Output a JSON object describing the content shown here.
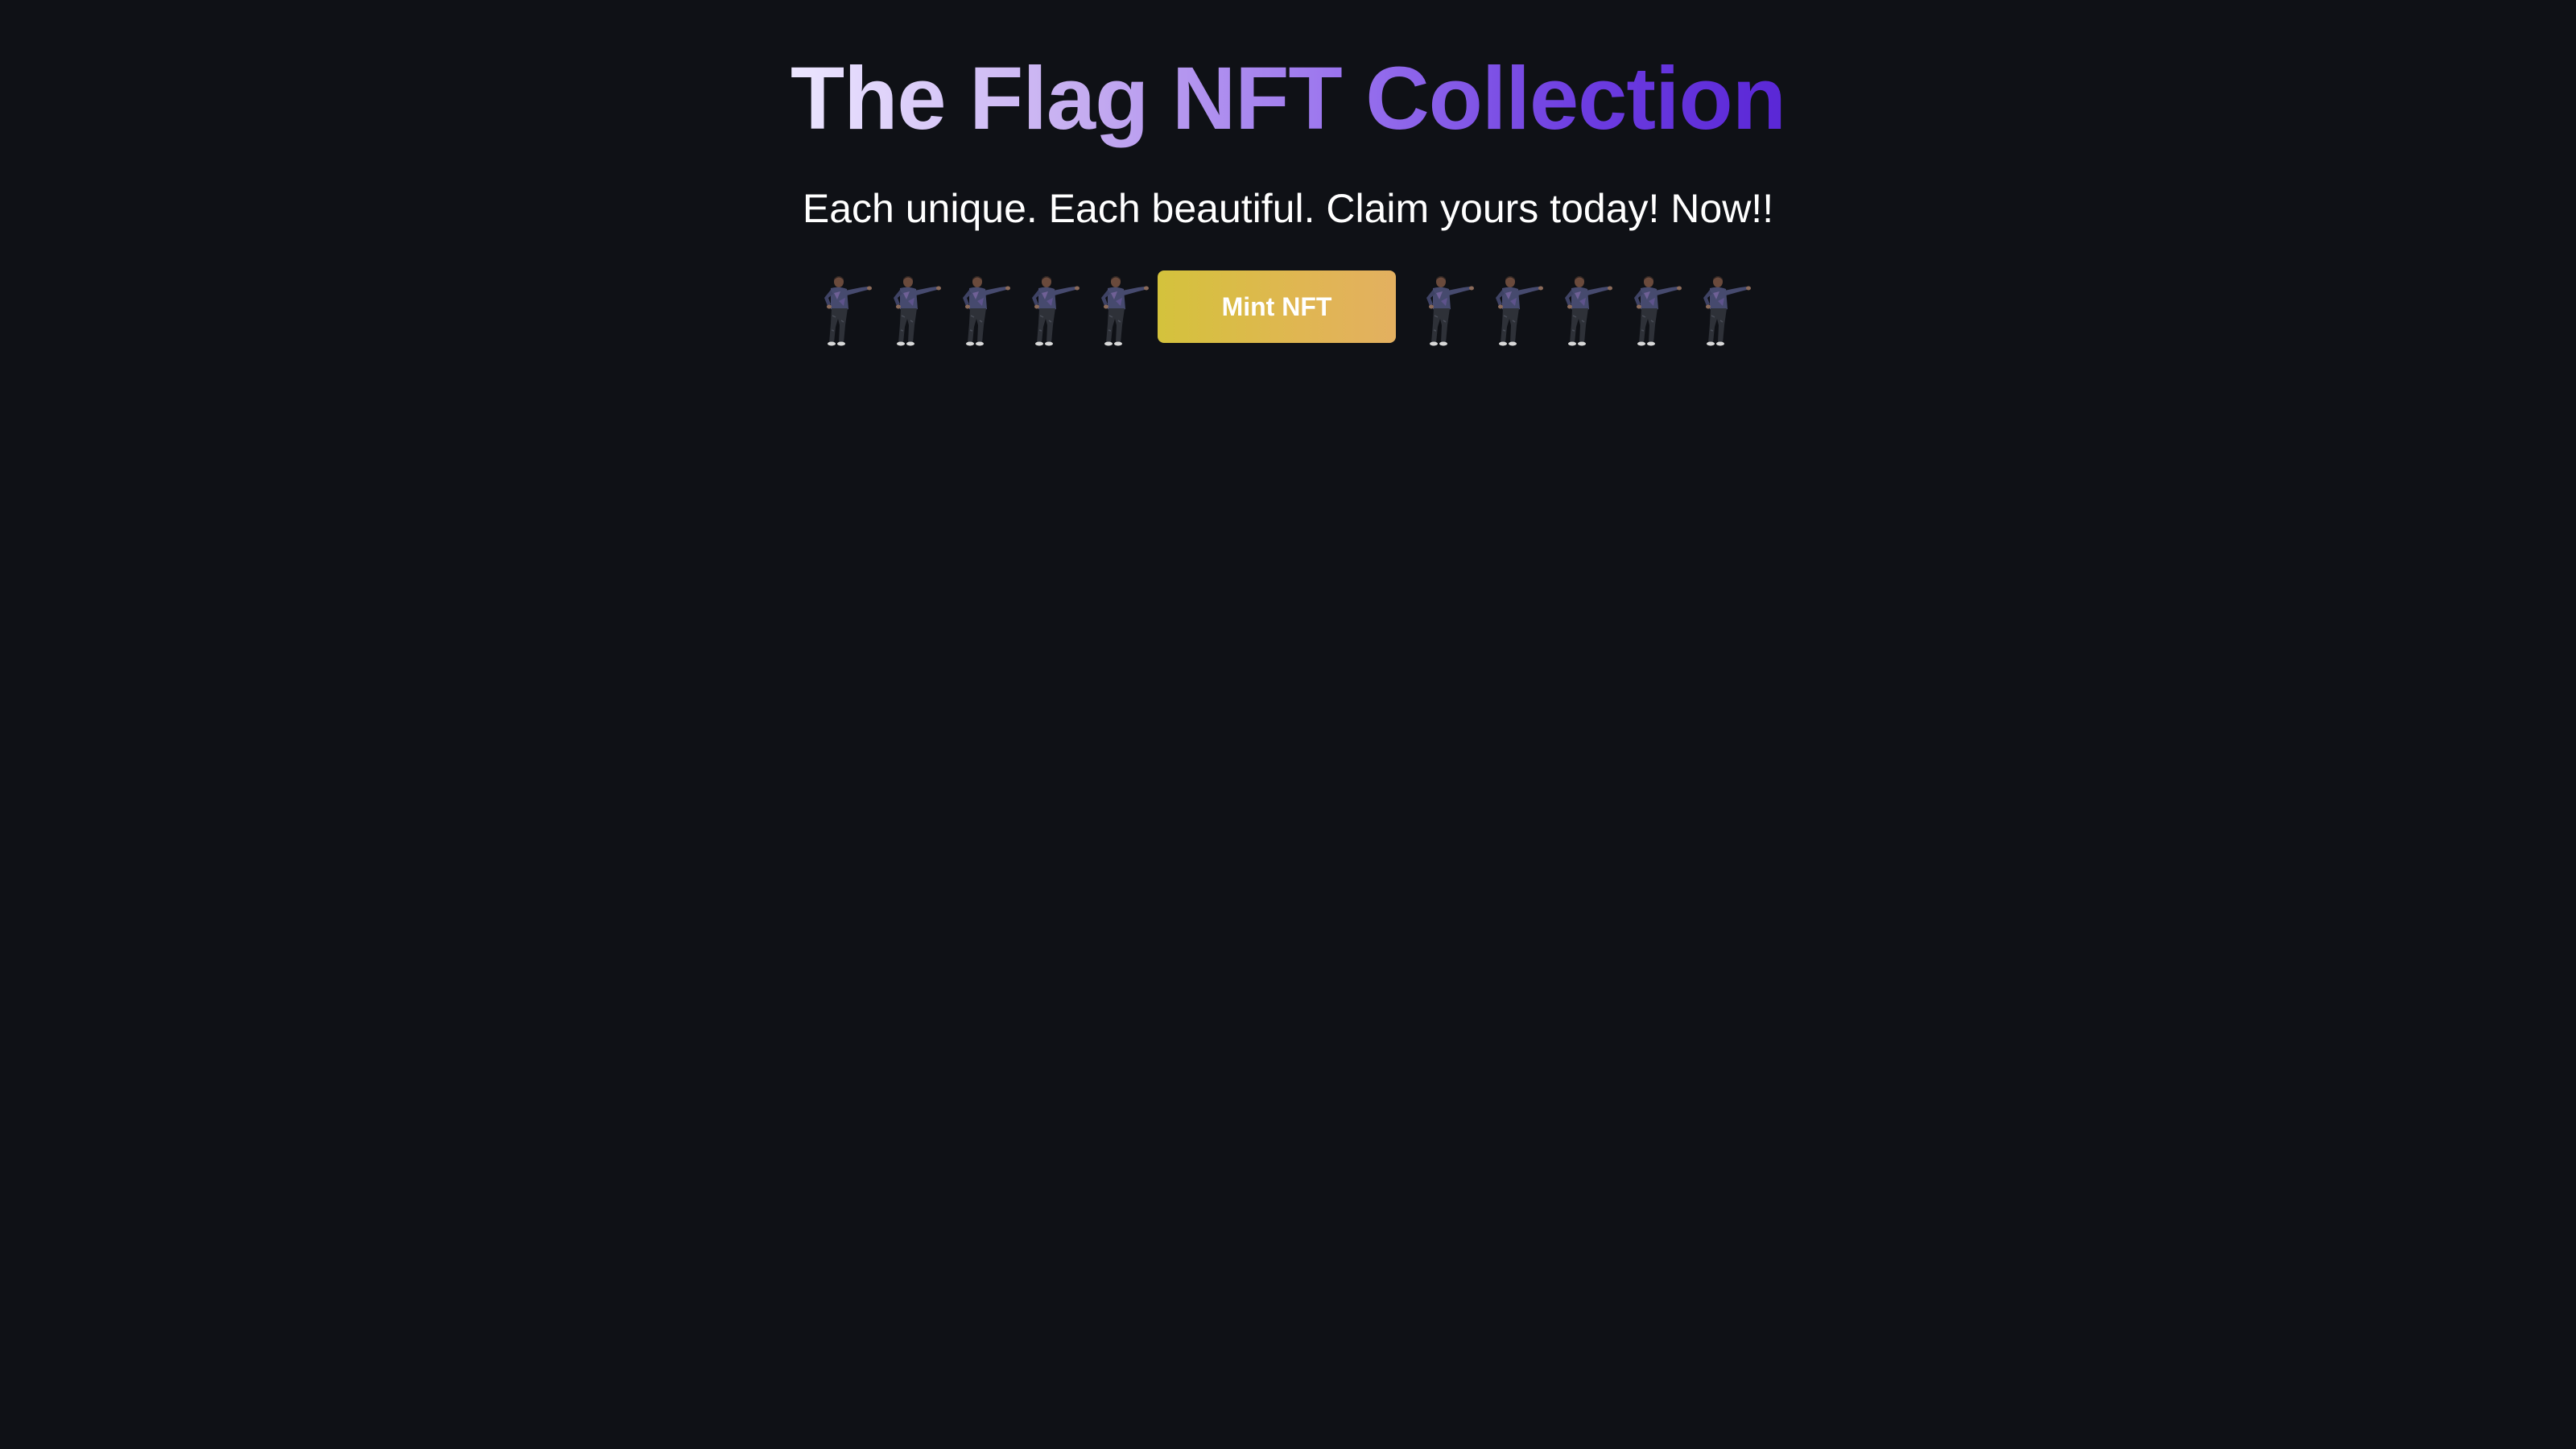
{
  "hero": {
    "title": "The Flag NFT Collection",
    "subtitle": "Each unique. Each beautiful. Claim yours today! Now!!"
  },
  "mint": {
    "button_label": "Mint NFT",
    "dancers_left_count": 5,
    "dancers_right_count": 5
  },
  "colors": {
    "background": "#0f1116",
    "title_gradient": [
      "#ece6ff",
      "#9a74ee",
      "#5a27d6"
    ],
    "button_gradient": [
      "#d4c23c",
      "#e3b060"
    ],
    "text": "#ffffff"
  },
  "icons": {
    "dancer": "dancing-man-icon"
  }
}
